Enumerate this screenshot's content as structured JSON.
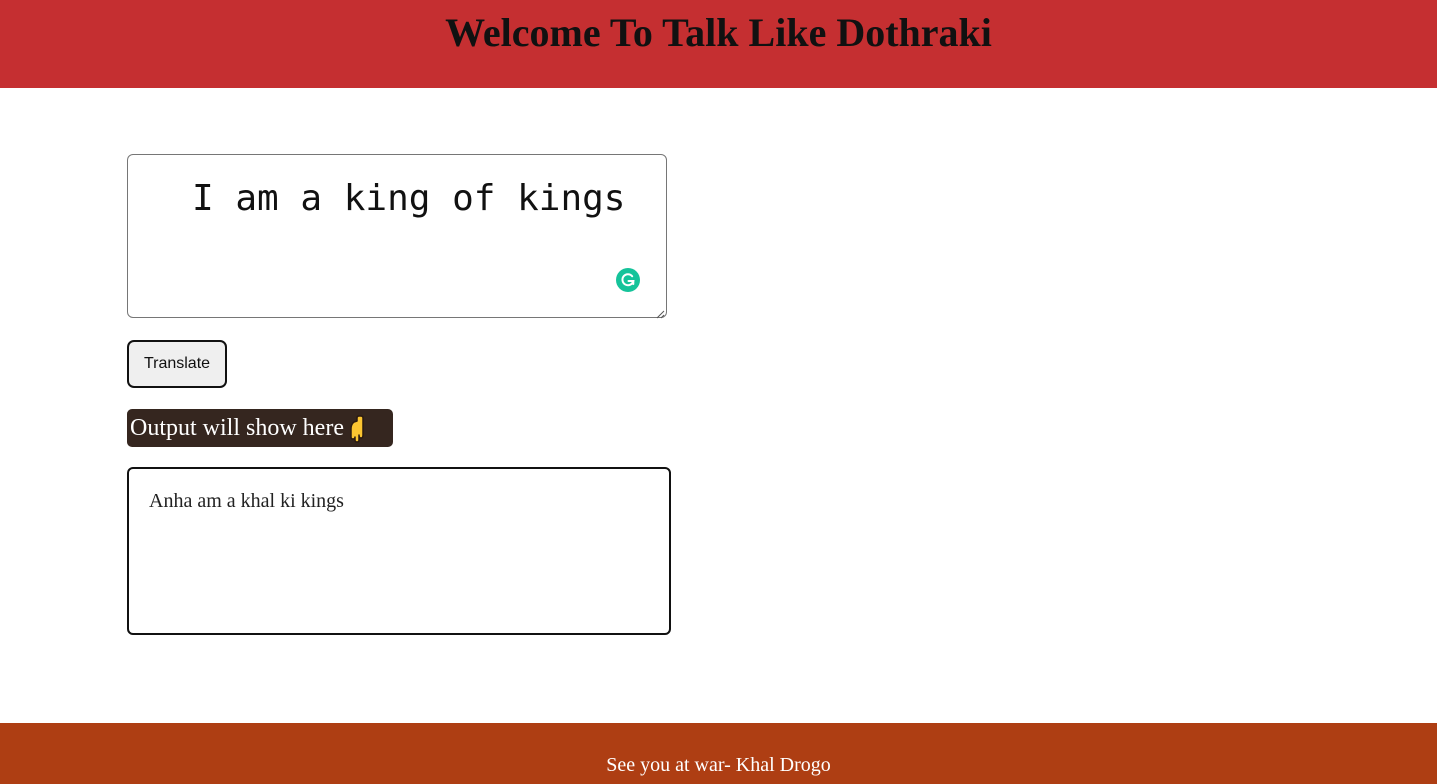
{
  "header": {
    "title": "Welcome To Talk Like Dothraki",
    "background": "#c52f31"
  },
  "input": {
    "value": "I am a king of kings",
    "extension_icon": "grammarly-icon",
    "extension_color": "#15c39a"
  },
  "translate_button": {
    "label": "Translate"
  },
  "output_label": {
    "text": "Output will show here",
    "icon": "pointing-down-hand-icon",
    "background": "#35261f"
  },
  "output": {
    "text": "Anha am a khal ki kings"
  },
  "footer": {
    "text": "See you at war- Khal Drogo",
    "background": "#ae3e13"
  }
}
